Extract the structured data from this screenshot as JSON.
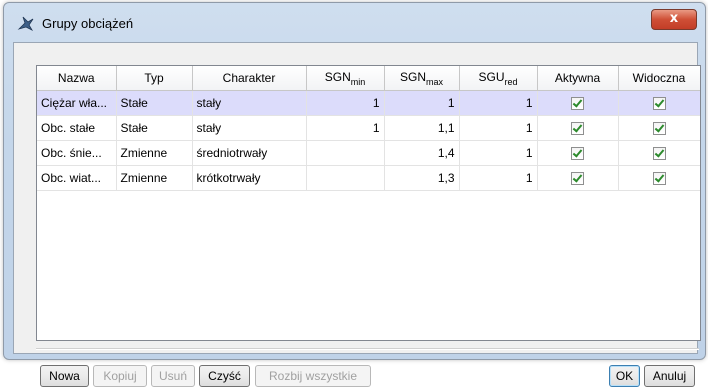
{
  "window": {
    "title": "Grupy obciążeń",
    "close_label": "x"
  },
  "table": {
    "columns": [
      {
        "main": "Nazwa",
        "sub": ""
      },
      {
        "main": "Typ",
        "sub": ""
      },
      {
        "main": "Charakter",
        "sub": ""
      },
      {
        "main": "SGN",
        "sub": "min"
      },
      {
        "main": "SGN",
        "sub": "max"
      },
      {
        "main": "SGU",
        "sub": "red"
      },
      {
        "main": "Aktywna",
        "sub": ""
      },
      {
        "main": "Widoczna",
        "sub": ""
      }
    ],
    "rows": [
      {
        "nazwa": "Ciężar wła...",
        "typ": "Stałe",
        "charakter": "stały",
        "sgn_min": "1",
        "sgn_max": "1",
        "sgu_red": "1",
        "aktywna": true,
        "widoczna": true,
        "selected": true
      },
      {
        "nazwa": "Obc. stałe",
        "typ": "Stałe",
        "charakter": "stały",
        "sgn_min": "1",
        "sgn_max": "1,1",
        "sgu_red": "1",
        "aktywna": true,
        "widoczna": true,
        "selected": false
      },
      {
        "nazwa": "Obc. śnie...",
        "typ": "Zmienne",
        "charakter": "średniotrwały",
        "sgn_min": "",
        "sgn_max": "1,4",
        "sgu_red": "1",
        "aktywna": true,
        "widoczna": true,
        "selected": false
      },
      {
        "nazwa": "Obc. wiat...",
        "typ": "Zmienne",
        "charakter": "krótkotrwały",
        "sgn_min": "",
        "sgn_max": "1,3",
        "sgu_red": "1",
        "aktywna": true,
        "widoczna": true,
        "selected": false
      }
    ]
  },
  "buttons": {
    "nowa": "Nowa",
    "kopiuj": "Kopiuj",
    "usun": "Usuń",
    "czysc": "Czyść",
    "rozbij": "Rozbij wszystkie",
    "ok": "OK",
    "anuluj": "Anuluj"
  }
}
